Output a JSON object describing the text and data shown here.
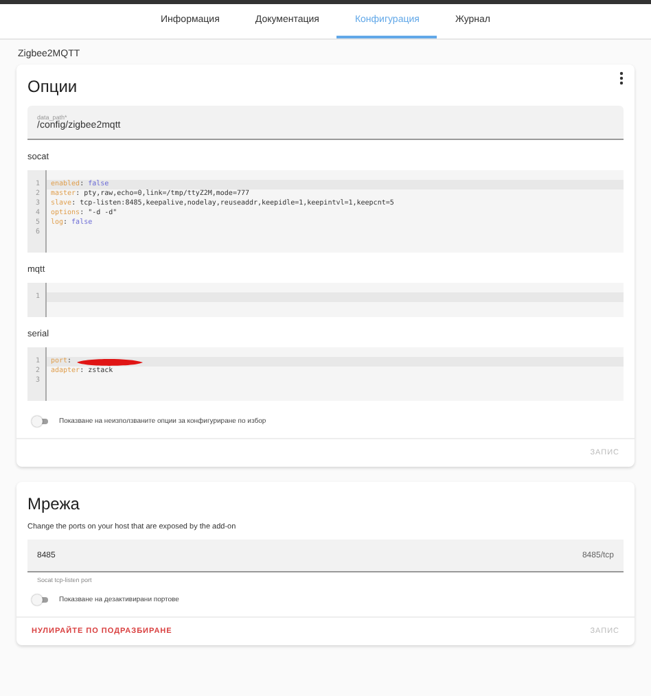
{
  "tabs": [
    {
      "label": "Информация",
      "selected": false
    },
    {
      "label": "Документация",
      "selected": false
    },
    {
      "label": "Конфигурация",
      "selected": true
    },
    {
      "label": "Журнал",
      "selected": false
    }
  ],
  "addon_name": "Zigbee2MQTT",
  "options_card": {
    "title": "Опции",
    "data_path_field": {
      "label": "data_path*",
      "value": "/config/zigbee2mqtt"
    },
    "editors": [
      {
        "label": "socat",
        "lines": [
          {
            "number": "1",
            "active": true,
            "tokens": [
              {
                "kind": "key",
                "text": "enabled"
              },
              {
                "kind": "punct",
                "text": ":"
              },
              {
                "kind": "bool",
                "text": "false"
              }
            ]
          },
          {
            "number": "2",
            "active": false,
            "tokens": [
              {
                "kind": "key",
                "text": "master"
              },
              {
                "kind": "punct",
                "text": ":"
              },
              {
                "kind": "plain",
                "text": "pty,raw,echo=0,link=/tmp/ttyZ2M,mode=777"
              }
            ]
          },
          {
            "number": "3",
            "active": false,
            "tokens": [
              {
                "kind": "key",
                "text": "slave"
              },
              {
                "kind": "punct",
                "text": ":"
              },
              {
                "kind": "plain",
                "text": "tcp-listen:8485,keepalive,nodelay,reuseaddr,keepidle=1,keepintvl=1,keepcnt=5"
              }
            ]
          },
          {
            "number": "4",
            "active": false,
            "tokens": [
              {
                "kind": "key",
                "text": "options"
              },
              {
                "kind": "punct",
                "text": ":"
              },
              {
                "kind": "plain",
                "text": "\"-d -d\""
              }
            ]
          },
          {
            "number": "5",
            "active": false,
            "tokens": [
              {
                "kind": "key",
                "text": "log"
              },
              {
                "kind": "punct",
                "text": ":"
              },
              {
                "kind": "bool",
                "text": "false"
              }
            ]
          },
          {
            "number": "6",
            "active": false
          }
        ]
      },
      {
        "label": "mqtt",
        "lines": [
          {
            "number": "1",
            "active": true
          }
        ]
      },
      {
        "label": "serial",
        "lines": [
          {
            "number": "1",
            "active": true,
            "tokens": [
              {
                "kind": "key",
                "text": "port"
              },
              {
                "kind": "punct",
                "text": ":"
              },
              {
                "kind": "redaction"
              }
            ]
          },
          {
            "number": "2",
            "active": false,
            "tokens": [
              {
                "kind": "key",
                "text": "adapter"
              },
              {
                "kind": "punct",
                "text": ":"
              },
              {
                "kind": "plain",
                "text": "zstack"
              }
            ]
          },
          {
            "number": "3",
            "active": false
          }
        ]
      }
    ],
    "toggle": {
      "label": "Показване на неизползваните опции за конфигуриране по избор",
      "on": false
    },
    "save_button": {
      "label": "ЗАПИС",
      "disabled": true
    }
  },
  "network_card": {
    "title": "Мрежа",
    "description": "Change the ports on your host that are exposed by the add-on",
    "port_field": {
      "value": "8485",
      "suffix": "8485/tcp",
      "helper": "Socat tcp-listen port"
    },
    "toggle": {
      "label": "Показване на дезактивирани портове",
      "on": false
    },
    "reset_button": {
      "label": "НУЛИРАЙТЕ ПО ПОДРАЗБИРАНЕ"
    },
    "save_button": {
      "label": "ЗАПИС",
      "disabled": true
    }
  }
}
